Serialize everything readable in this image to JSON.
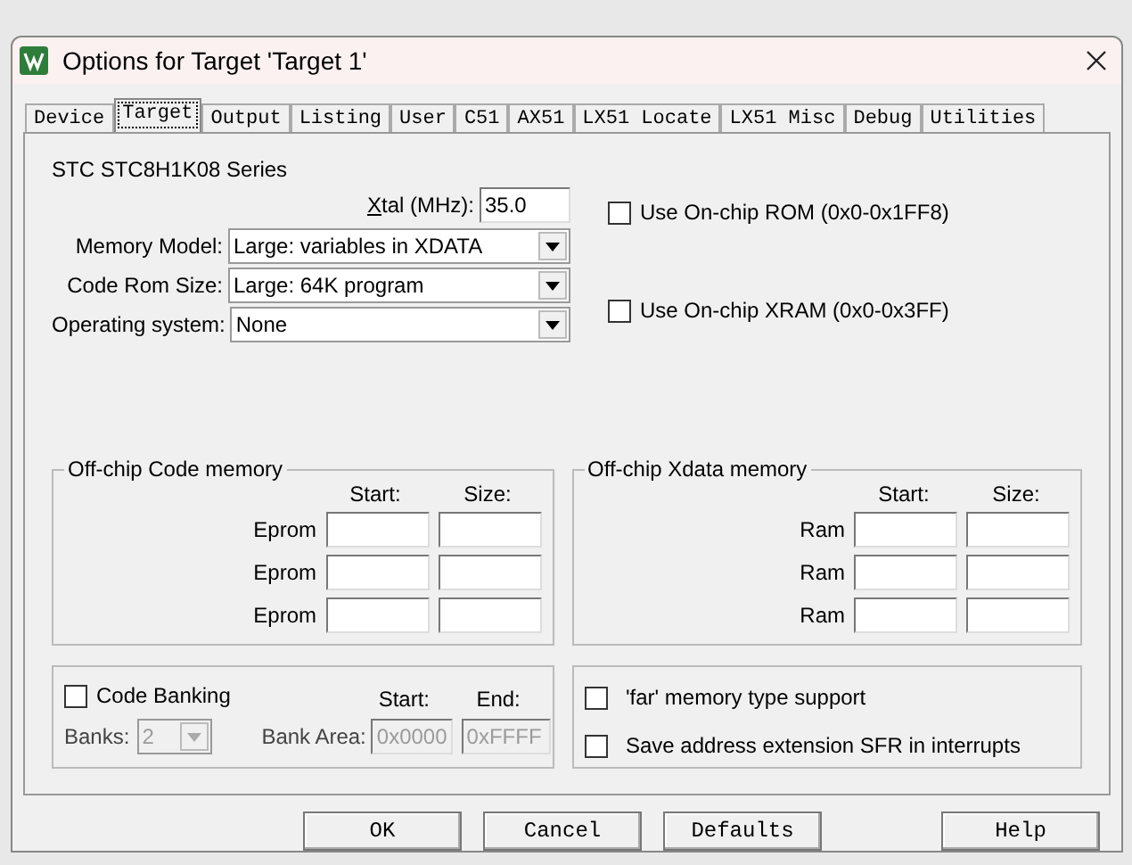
{
  "window": {
    "title": "Options for Target 'Target 1'"
  },
  "tabs": [
    {
      "label": "Device",
      "selected": false
    },
    {
      "label": "Target",
      "selected": true
    },
    {
      "label": "Output",
      "selected": false
    },
    {
      "label": "Listing",
      "selected": false
    },
    {
      "label": "User",
      "selected": false
    },
    {
      "label": "C51",
      "selected": false
    },
    {
      "label": "AX51",
      "selected": false
    },
    {
      "label": "LX51 Locate",
      "selected": false
    },
    {
      "label": "LX51 Misc",
      "selected": false
    },
    {
      "label": "Debug",
      "selected": false
    },
    {
      "label": "Utilities",
      "selected": false
    }
  ],
  "device": "STC STC8H1K08 Series",
  "xtal": {
    "label": "Xtal (MHz):",
    "value": "35.0"
  },
  "selects": [
    {
      "label": "Memory Model:",
      "value": "Large: variables in XDATA"
    },
    {
      "label": "Code Rom Size:",
      "value": "Large: 64K program"
    },
    {
      "label": "Operating system:",
      "value": "None"
    }
  ],
  "onchip": [
    {
      "label": "Use On-chip ROM (0x0-0x1FF8)",
      "checked": false
    },
    {
      "label": "Use On-chip XRAM (0x0-0x3FF)",
      "checked": false
    }
  ],
  "memory_groups": [
    {
      "title": "Off-chip Code memory",
      "start_heading": "Start:",
      "size_heading": "Size:",
      "rows": [
        "Eprom",
        "Eprom",
        "Eprom"
      ]
    },
    {
      "title": "Off-chip Xdata memory",
      "start_heading": "Start:",
      "size_heading": "Size:",
      "rows": [
        "Ram",
        "Ram",
        "Ram"
      ]
    }
  ],
  "banking": {
    "label": "Code Banking",
    "checked": false,
    "banks_label": "Banks:",
    "banks_value": "2",
    "bank_area_label": "Bank Area:",
    "start_heading": "Start:",
    "end_heading": "End:",
    "start_value": "0x0000",
    "end_value": "0xFFFF",
    "disabled": true
  },
  "options": [
    {
      "label": "'far' memory type support",
      "checked": false
    },
    {
      "label": "Save address extension SFR in interrupts",
      "checked": false
    }
  ],
  "buttons": [
    "OK",
    "Cancel",
    "Defaults",
    "Help"
  ]
}
